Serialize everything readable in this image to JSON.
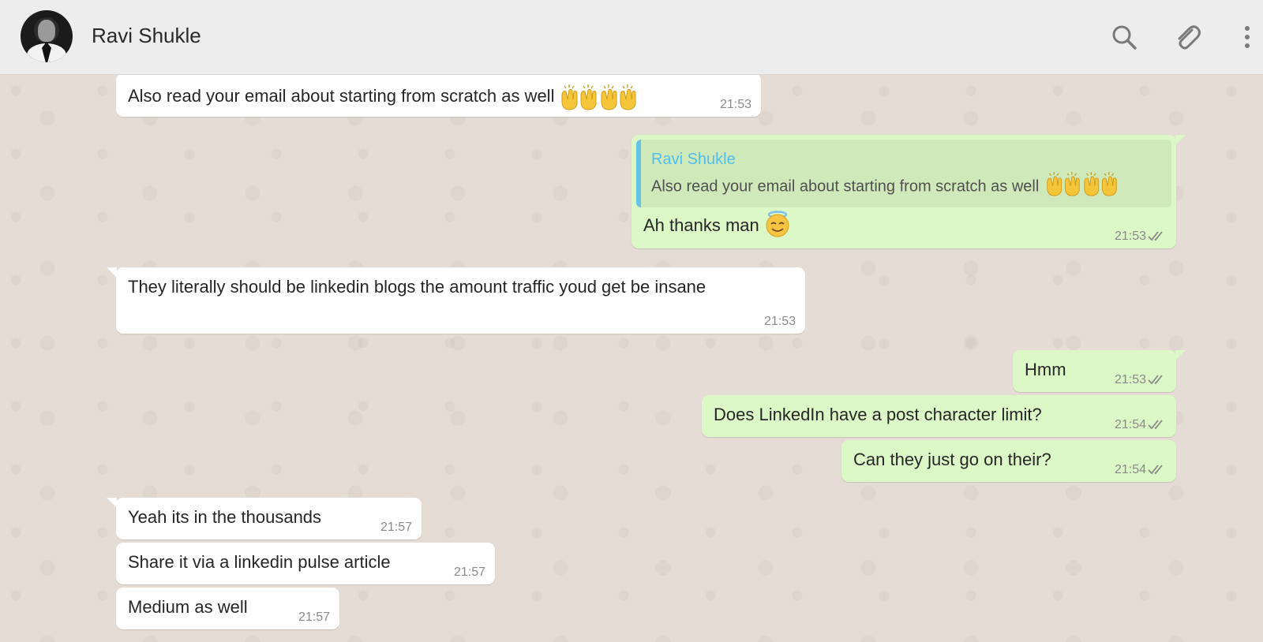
{
  "header": {
    "contact_name": "Ravi Shukle",
    "icons": [
      "search-icon",
      "attach-icon",
      "more-icon"
    ]
  },
  "messages": [
    {
      "id": "m1",
      "direction": "incoming",
      "text": "Also read your email about starting from scratch as well",
      "emoji": "raising-hands",
      "time": "21:53"
    },
    {
      "id": "m2",
      "direction": "outgoing",
      "reply_to": {
        "name": "Ravi Shukle",
        "text": "Also read your email about starting from scratch as well"
      },
      "text": "Ah thanks man",
      "emoji": "smiling-face-with-halo",
      "time": "21:53",
      "status": "read"
    },
    {
      "id": "m3",
      "direction": "incoming",
      "text": "They literally should be linkedin blogs the amount traffic youd get be insane",
      "time": "21:53"
    },
    {
      "id": "m4",
      "direction": "outgoing",
      "text": "Hmm",
      "time": "21:53",
      "status": "read"
    },
    {
      "id": "m5",
      "direction": "outgoing",
      "text": "Does LinkedIn have a post character limit?",
      "time": "21:54",
      "status": "read"
    },
    {
      "id": "m6",
      "direction": "outgoing",
      "text": "Can they just go on their?",
      "time": "21:54",
      "status": "read"
    },
    {
      "id": "m7",
      "direction": "incoming",
      "text": "Yeah its in the thousands",
      "time": "21:57"
    },
    {
      "id": "m8",
      "direction": "incoming",
      "text": "Share it via a linkedin pulse article",
      "time": "21:57"
    },
    {
      "id": "m9",
      "direction": "incoming",
      "text": "Medium as well",
      "time": "21:57"
    }
  ],
  "colors": {
    "header_bg": "#ededed",
    "chat_bg": "#e5ddd5",
    "incoming_bubble": "#ffffff",
    "outgoing_bubble": "#dcf8c6",
    "quote_bar": "#65c3e8",
    "quote_name": "#53bdeb",
    "tick": "#8a8a8a"
  }
}
